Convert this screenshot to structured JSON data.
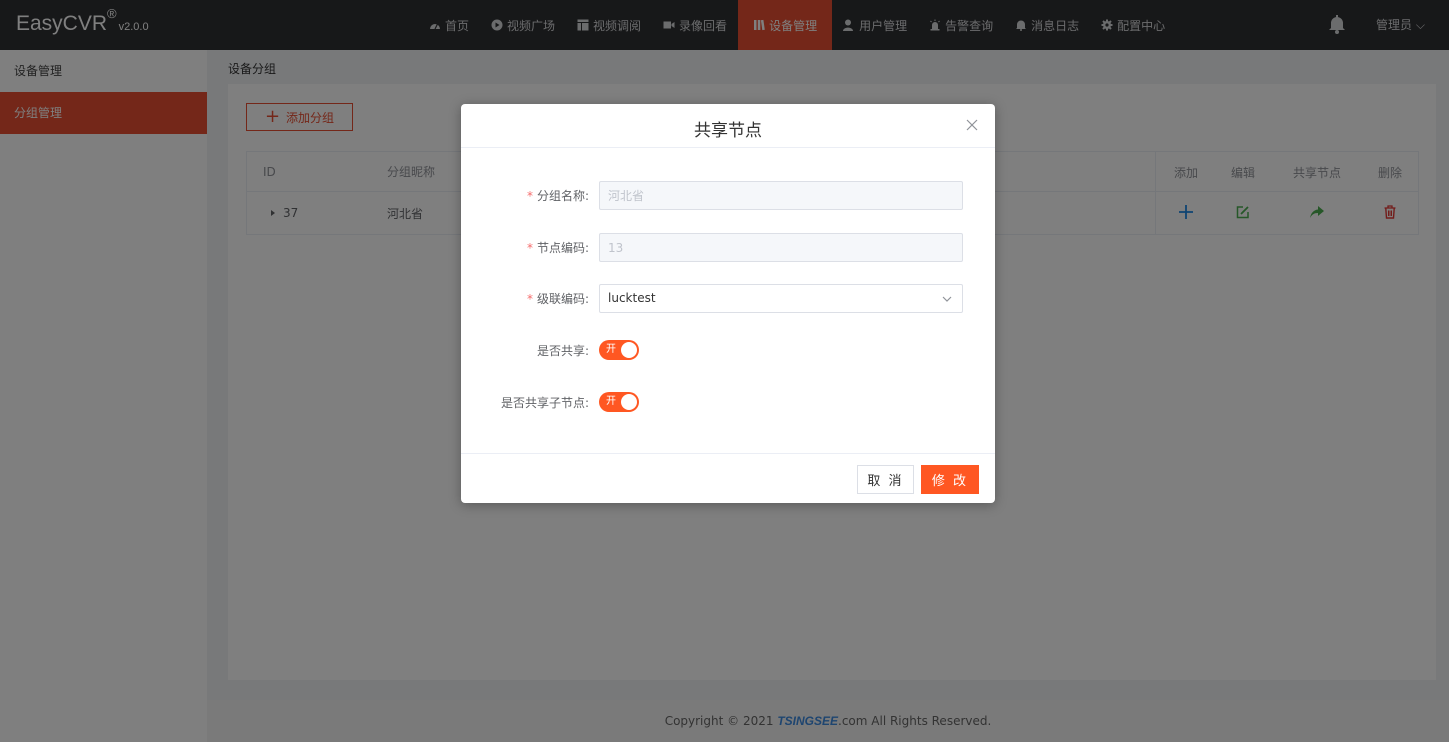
{
  "app": {
    "logo": "EasyCVR",
    "logo_mark": "®",
    "version": "v2.0.0"
  },
  "nav": [
    {
      "label": "首页",
      "icon": "dashboard-icon"
    },
    {
      "label": "视频广场",
      "icon": "play-icon"
    },
    {
      "label": "视频调阅",
      "icon": "grid-icon"
    },
    {
      "label": "录像回看",
      "icon": "camera-icon"
    },
    {
      "label": "设备管理",
      "icon": "device-icon",
      "active": true
    },
    {
      "label": "用户管理",
      "icon": "user-icon"
    },
    {
      "label": "告警查询",
      "icon": "alarm-icon"
    },
    {
      "label": "消息日志",
      "icon": "bell-icon"
    },
    {
      "label": "配置中心",
      "icon": "gear-icon"
    }
  ],
  "header": {
    "user": "管理员 ⌵"
  },
  "sidebar": {
    "items": [
      {
        "label": "设备管理"
      },
      {
        "label": "分组管理",
        "active": true
      }
    ]
  },
  "main": {
    "breadcrumb": "设备分组",
    "add_group": "添加分组",
    "table": {
      "headers": {
        "id": "ID",
        "name": "分组昵称",
        "add": "添加",
        "edit": "编辑",
        "share": "共享节点",
        "delete": "删除"
      },
      "rows": [
        {
          "id": "37",
          "name": "河北省"
        }
      ]
    }
  },
  "dialog": {
    "title": "共享节点",
    "fields": {
      "group_name": {
        "label": "分组名称:",
        "value": "河北省"
      },
      "node_code": {
        "label": "节点编码:",
        "value": "13"
      },
      "cascade_code": {
        "label": "级联编码:",
        "value": "lucktest"
      },
      "share": {
        "label": "是否共享:",
        "state": "开"
      },
      "share_children": {
        "label": "是否共享子节点:",
        "state": "开"
      }
    },
    "required_mark": "*",
    "cancel": "取 消",
    "confirm": "修 改"
  },
  "footer": {
    "prefix": "Copyright © 2021 ",
    "brand": "TSINGSEE",
    "suffix": ".com All Rights Reserved."
  },
  "colors": {
    "accent": "#e94f33",
    "switch": "#ff5722",
    "topbar": "#2f3033",
    "add_icon": "#1e88e5",
    "edit_icon": "#4caf50",
    "share_icon": "#4caf50",
    "delete_icon": "#e53935"
  }
}
